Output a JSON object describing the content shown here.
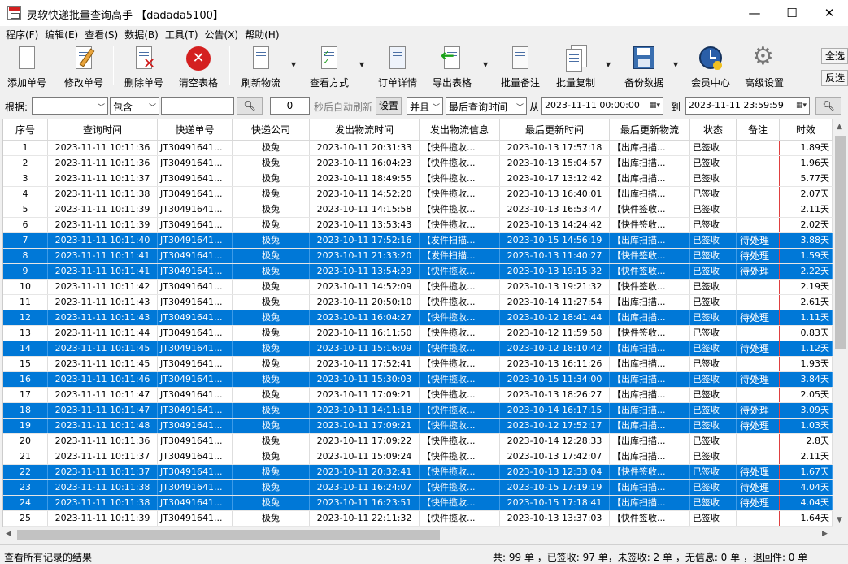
{
  "window": {
    "title": "灵软快递批量查询高手 【dadada5100】",
    "minimize": "—",
    "maximize": "☐",
    "close": "✕"
  },
  "menu": [
    {
      "label": "程序(F)"
    },
    {
      "label": "编辑(E)"
    },
    {
      "label": "查看(S)"
    },
    {
      "label": "数据(B)"
    },
    {
      "label": "工具(T)"
    },
    {
      "label": "公告(X)"
    },
    {
      "label": "帮助(H)"
    }
  ],
  "toolbar": {
    "add": "添加单号",
    "edit": "修改单号",
    "delete": "删除单号",
    "clear": "清空表格",
    "refresh": "刷新物流",
    "view_mode": "查看方式",
    "order_detail": "订单详情",
    "export": "导出表格",
    "batch_remark": "批量备注",
    "batch_copy": "批量复制",
    "backup": "备份数据",
    "member": "会员中心",
    "settings": "高级设置",
    "select_all": "全选",
    "invert": "反选"
  },
  "filter": {
    "basis_label": "根据:",
    "basis_value": "",
    "match_value": "包含",
    "keyword": "",
    "auto_refresh_seconds": "0",
    "auto_refresh_label": "秒后自动刷新",
    "set_button": "设置",
    "logic_value": "并且",
    "time_field_value": "最后查询时间",
    "from_label": "从",
    "from_date": "2023-11-11 00:00:00",
    "to_label": "到",
    "to_date": "2023-11-11 23:59:59"
  },
  "grid": {
    "columns": [
      "序号",
      "查询时间",
      "快递单号",
      "快递公司",
      "发出物流时间",
      "发出物流信息",
      "最后更新时间",
      "最后更新物流",
      "状态",
      "备注",
      "时效"
    ],
    "rows": [
      {
        "no": "1",
        "query_time": "2023-11-11 10:11:36",
        "tracking": "JT30491641...",
        "company": "极兔",
        "ship_time": "2023-10-11 20:31:33",
        "ship_info": "【快件揽收...",
        "update_time": "2023-10-13 17:57:18",
        "update_info": "【出库扫描...",
        "status": "已签收",
        "remark": "",
        "duration": "1.89天",
        "selected": false
      },
      {
        "no": "2",
        "query_time": "2023-11-11 10:11:36",
        "tracking": "JT30491641...",
        "company": "极兔",
        "ship_time": "2023-10-11 16:04:23",
        "ship_info": "【快件揽收...",
        "update_time": "2023-10-13 15:04:57",
        "update_info": "【出库扫描...",
        "status": "已签收",
        "remark": "",
        "duration": "1.96天",
        "selected": false
      },
      {
        "no": "3",
        "query_time": "2023-11-11 10:11:37",
        "tracking": "JT30491641...",
        "company": "极兔",
        "ship_time": "2023-10-11 18:49:55",
        "ship_info": "【快件揽收...",
        "update_time": "2023-10-17 13:12:42",
        "update_info": "【出库扫描...",
        "status": "已签收",
        "remark": "",
        "duration": "5.77天",
        "selected": false
      },
      {
        "no": "4",
        "query_time": "2023-11-11 10:11:38",
        "tracking": "JT30491641...",
        "company": "极兔",
        "ship_time": "2023-10-11 14:52:20",
        "ship_info": "【快件揽收...",
        "update_time": "2023-10-13 16:40:01",
        "update_info": "【出库扫描...",
        "status": "已签收",
        "remark": "",
        "duration": "2.07天",
        "selected": false
      },
      {
        "no": "5",
        "query_time": "2023-11-11 10:11:39",
        "tracking": "JT30491641...",
        "company": "极兔",
        "ship_time": "2023-10-11 14:15:58",
        "ship_info": "【快件揽收...",
        "update_time": "2023-10-13 16:53:47",
        "update_info": "【快件签收...",
        "status": "已签收",
        "remark": "",
        "duration": "2.11天",
        "selected": false
      },
      {
        "no": "6",
        "query_time": "2023-11-11 10:11:39",
        "tracking": "JT30491641...",
        "company": "极兔",
        "ship_time": "2023-10-11 13:53:43",
        "ship_info": "【快件揽收...",
        "update_time": "2023-10-13 14:24:42",
        "update_info": "【快件签收...",
        "status": "已签收",
        "remark": "",
        "duration": "2.02天",
        "selected": false
      },
      {
        "no": "7",
        "query_time": "2023-11-11 10:11:40",
        "tracking": "JT30491641...",
        "company": "极兔",
        "ship_time": "2023-10-11 17:52:16",
        "ship_info": "【发件扫描...",
        "update_time": "2023-10-15 14:56:19",
        "update_info": "【出库扫描...",
        "status": "已签收",
        "remark": "待处理",
        "duration": "3.88天",
        "selected": true
      },
      {
        "no": "8",
        "query_time": "2023-11-11 10:11:41",
        "tracking": "JT30491641...",
        "company": "极兔",
        "ship_time": "2023-10-11 21:33:20",
        "ship_info": "【发件扫描...",
        "update_time": "2023-10-13 11:40:27",
        "update_info": "【快件签收...",
        "status": "已签收",
        "remark": "待处理",
        "duration": "1.59天",
        "selected": true
      },
      {
        "no": "9",
        "query_time": "2023-11-11 10:11:41",
        "tracking": "JT30491641...",
        "company": "极兔",
        "ship_time": "2023-10-11 13:54:29",
        "ship_info": "【快件揽收...",
        "update_time": "2023-10-13 19:15:32",
        "update_info": "【快件签收...",
        "status": "已签收",
        "remark": "待处理",
        "duration": "2.22天",
        "selected": true
      },
      {
        "no": "10",
        "query_time": "2023-11-11 10:11:42",
        "tracking": "JT30491641...",
        "company": "极兔",
        "ship_time": "2023-10-11 14:52:09",
        "ship_info": "【快件揽收...",
        "update_time": "2023-10-13 19:21:32",
        "update_info": "【快件签收...",
        "status": "已签收",
        "remark": "",
        "duration": "2.19天",
        "selected": false
      },
      {
        "no": "11",
        "query_time": "2023-11-11 10:11:43",
        "tracking": "JT30491641...",
        "company": "极兔",
        "ship_time": "2023-10-11 20:50:10",
        "ship_info": "【快件揽收...",
        "update_time": "2023-10-14 11:27:54",
        "update_info": "【出库扫描...",
        "status": "已签收",
        "remark": "",
        "duration": "2.61天",
        "selected": false
      },
      {
        "no": "12",
        "query_time": "2023-11-11 10:11:43",
        "tracking": "JT30491641...",
        "company": "极兔",
        "ship_time": "2023-10-11 16:04:27",
        "ship_info": "【快件揽收...",
        "update_time": "2023-10-12 18:41:44",
        "update_info": "【出库扫描...",
        "status": "已签收",
        "remark": "待处理",
        "duration": "1.11天",
        "selected": true
      },
      {
        "no": "13",
        "query_time": "2023-11-11 10:11:44",
        "tracking": "JT30491641...",
        "company": "极兔",
        "ship_time": "2023-10-11 16:11:50",
        "ship_info": "【快件揽收...",
        "update_time": "2023-10-12 11:59:58",
        "update_info": "【快件签收...",
        "status": "已签收",
        "remark": "",
        "duration": "0.83天",
        "selected": false
      },
      {
        "no": "14",
        "query_time": "2023-11-11 10:11:45",
        "tracking": "JT30491641...",
        "company": "极兔",
        "ship_time": "2023-10-11 15:16:09",
        "ship_info": "【快件揽收...",
        "update_time": "2023-10-12 18:10:42",
        "update_info": "【出库扫描...",
        "status": "已签收",
        "remark": "待处理",
        "duration": "1.12天",
        "selected": true
      },
      {
        "no": "15",
        "query_time": "2023-11-11 10:11:45",
        "tracking": "JT30491641...",
        "company": "极兔",
        "ship_time": "2023-10-11 17:52:41",
        "ship_info": "【快件揽收...",
        "update_time": "2023-10-13 16:11:26",
        "update_info": "【出库扫描...",
        "status": "已签收",
        "remark": "",
        "duration": "1.93天",
        "selected": false
      },
      {
        "no": "16",
        "query_time": "2023-11-11 10:11:46",
        "tracking": "JT30491641...",
        "company": "极兔",
        "ship_time": "2023-10-11 15:30:03",
        "ship_info": "【快件揽收...",
        "update_time": "2023-10-15 11:34:00",
        "update_info": "【出库扫描...",
        "status": "已签收",
        "remark": "待处理",
        "duration": "3.84天",
        "selected": true
      },
      {
        "no": "17",
        "query_time": "2023-11-11 10:11:47",
        "tracking": "JT30491641...",
        "company": "极兔",
        "ship_time": "2023-10-11 17:09:21",
        "ship_info": "【快件揽收...",
        "update_time": "2023-10-13 18:26:27",
        "update_info": "【出库扫描...",
        "status": "已签收",
        "remark": "",
        "duration": "2.05天",
        "selected": false
      },
      {
        "no": "18",
        "query_time": "2023-11-11 10:11:47",
        "tracking": "JT30491641...",
        "company": "极兔",
        "ship_time": "2023-10-11 14:11:18",
        "ship_info": "【快件揽收...",
        "update_time": "2023-10-14 16:17:15",
        "update_info": "【出库扫描...",
        "status": "已签收",
        "remark": "待处理",
        "duration": "3.09天",
        "selected": true
      },
      {
        "no": "19",
        "query_time": "2023-11-11 10:11:48",
        "tracking": "JT30491641...",
        "company": "极兔",
        "ship_time": "2023-10-11 17:09:21",
        "ship_info": "【快件揽收...",
        "update_time": "2023-10-12 17:52:17",
        "update_info": "【出库扫描...",
        "status": "已签收",
        "remark": "待处理",
        "duration": "1.03天",
        "selected": true
      },
      {
        "no": "20",
        "query_time": "2023-11-11 10:11:36",
        "tracking": "JT30491641...",
        "company": "极兔",
        "ship_time": "2023-10-11 17:09:22",
        "ship_info": "【快件揽收...",
        "update_time": "2023-10-14 12:28:33",
        "update_info": "【出库扫描...",
        "status": "已签收",
        "remark": "",
        "duration": "2.8天",
        "selected": false
      },
      {
        "no": "21",
        "query_time": "2023-11-11 10:11:37",
        "tracking": "JT30491641...",
        "company": "极兔",
        "ship_time": "2023-10-11 15:09:24",
        "ship_info": "【快件揽收...",
        "update_time": "2023-10-13 17:42:07",
        "update_info": "【出库扫描...",
        "status": "已签收",
        "remark": "",
        "duration": "2.11天",
        "selected": false
      },
      {
        "no": "22",
        "query_time": "2023-11-11 10:11:37",
        "tracking": "JT30491641...",
        "company": "极兔",
        "ship_time": "2023-10-11 20:32:41",
        "ship_info": "【快件揽收...",
        "update_time": "2023-10-13 12:33:04",
        "update_info": "【快件签收...",
        "status": "已签收",
        "remark": "待处理",
        "duration": "1.67天",
        "selected": true
      },
      {
        "no": "23",
        "query_time": "2023-11-11 10:11:38",
        "tracking": "JT30491641...",
        "company": "极兔",
        "ship_time": "2023-10-11 16:24:07",
        "ship_info": "【快件揽收...",
        "update_time": "2023-10-15 17:19:19",
        "update_info": "【出库扫描...",
        "status": "已签收",
        "remark": "待处理",
        "duration": "4.04天",
        "selected": true
      },
      {
        "no": "24",
        "query_time": "2023-11-11 10:11:38",
        "tracking": "JT30491641...",
        "company": "极兔",
        "ship_time": "2023-10-11 16:23:51",
        "ship_info": "【快件揽收...",
        "update_time": "2023-10-15 17:18:41",
        "update_info": "【出库扫描...",
        "status": "已签收",
        "remark": "待处理",
        "duration": "4.04天",
        "selected": true
      },
      {
        "no": "25",
        "query_time": "2023-11-11 10:11:39",
        "tracking": "JT30491641...",
        "company": "极兔",
        "ship_time": "2023-10-11 22:11:32",
        "ship_info": "【快件揽收...",
        "update_time": "2023-10-13 13:37:03",
        "update_info": "【快件签收...",
        "status": "已签收",
        "remark": "",
        "duration": "1.64天",
        "selected": false
      }
    ]
  },
  "statusbar": {
    "left": "查看所有记录的结果",
    "right": "共: 99 单 ，已签收: 97 单，未签收: 2 单 ，无信息: 0 单 ，退回件: 0 单"
  },
  "colors": {
    "selection": "#0078d7",
    "remark_border": "#e04040"
  }
}
